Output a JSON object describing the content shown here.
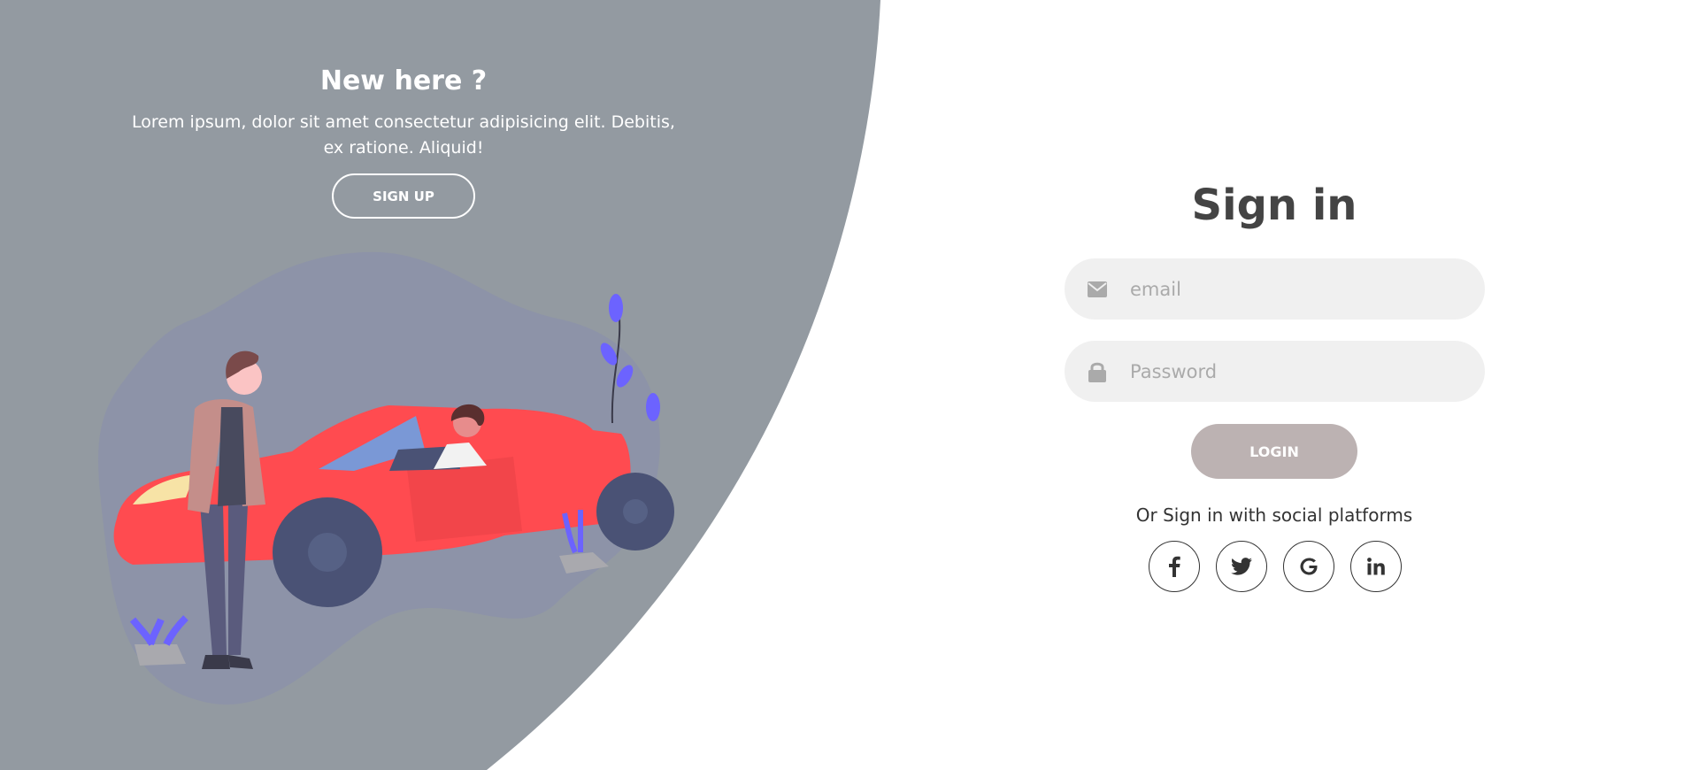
{
  "colors": {
    "panel_bg": "#939aa1",
    "blob": "#8d93a8",
    "car_red": "#ff4b50",
    "accent_purple": "#6c63ff",
    "input_bg": "#f0f0f0",
    "login_button": "#bcb2b2",
    "title": "#444444"
  },
  "left_panel": {
    "title": "New here ?",
    "text": "Lorem ipsum, dolor sit amet consectetur adipisicing elit. Debitis, ex ratione. Aliquid!",
    "signup_label": "SIGN UP"
  },
  "sign_in": {
    "title": "Sign in",
    "email": {
      "placeholder": "email",
      "value": "",
      "icon": "envelope-icon"
    },
    "password": {
      "placeholder": "Password",
      "value": "",
      "icon": "lock-icon"
    },
    "login_label": "LOGIN",
    "social_text": "Or Sign in with social platforms",
    "socials": [
      {
        "name": "facebook",
        "icon": "facebook-icon"
      },
      {
        "name": "twitter",
        "icon": "twitter-icon"
      },
      {
        "name": "google",
        "icon": "google-icon"
      },
      {
        "name": "linkedin",
        "icon": "linkedin-icon"
      }
    ]
  }
}
